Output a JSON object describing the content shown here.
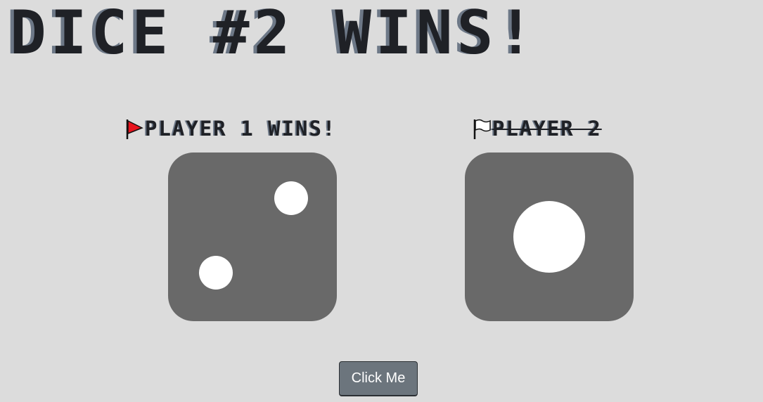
{
  "game": {
    "title": "DICE #2 WINS!",
    "players": [
      {
        "label": "PLAYER 1 WINS!",
        "flag_icon": "red-flag-icon",
        "flag_color": "#e8141e",
        "die_value": 2
      },
      {
        "label": "PLAYER 2",
        "flag_icon": "white-flag-icon",
        "flag_color": "#ffffff",
        "die_value": 1
      }
    ],
    "button_label": "Click Me"
  },
  "colors": {
    "background": "#dcdcdc",
    "text": "#1f2126",
    "text_shadow": "#6d7887",
    "die": "#696969",
    "pip": "#ffffff",
    "button": "#6c757d"
  }
}
